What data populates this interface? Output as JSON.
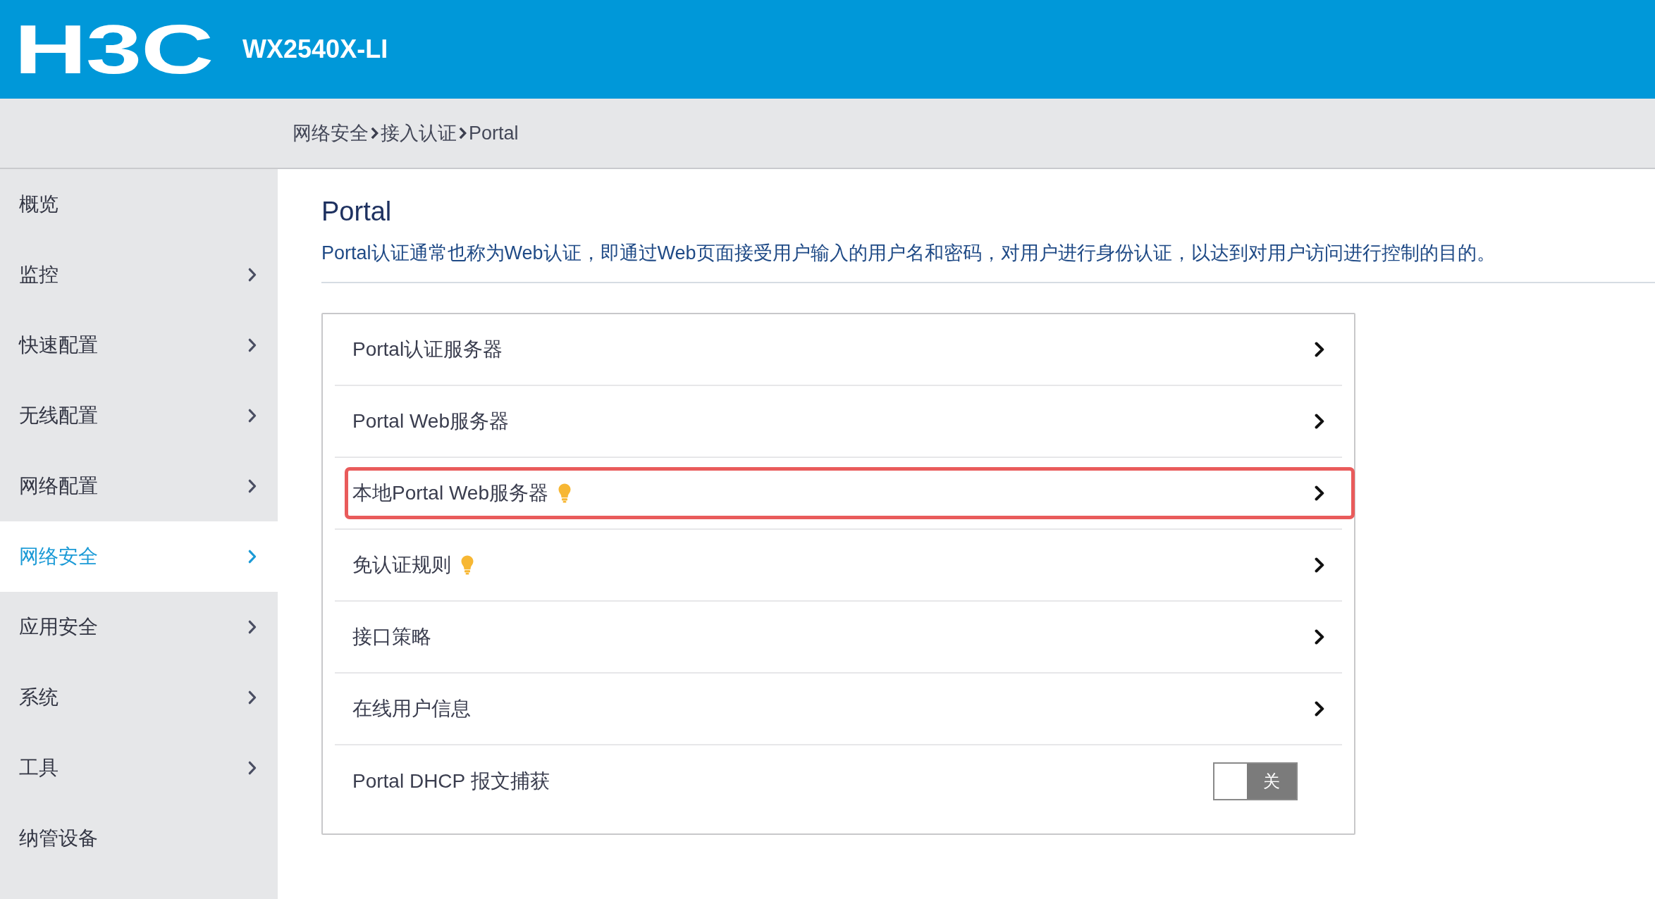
{
  "header": {
    "logo": "H3C",
    "model": "WX2540X-LI"
  },
  "breadcrumb": [
    "网络安全",
    "接入认证",
    "Portal"
  ],
  "sidebar": {
    "items": [
      {
        "label": "概览",
        "has_submenu": false,
        "selected": false
      },
      {
        "label": "监控",
        "has_submenu": true,
        "selected": false
      },
      {
        "label": "快速配置",
        "has_submenu": true,
        "selected": false
      },
      {
        "label": "无线配置",
        "has_submenu": true,
        "selected": false
      },
      {
        "label": "网络配置",
        "has_submenu": true,
        "selected": false
      },
      {
        "label": "网络安全",
        "has_submenu": true,
        "selected": true
      },
      {
        "label": "应用安全",
        "has_submenu": true,
        "selected": false
      },
      {
        "label": "系统",
        "has_submenu": true,
        "selected": false
      },
      {
        "label": "工具",
        "has_submenu": true,
        "selected": false
      },
      {
        "label": "纳管设备",
        "has_submenu": false,
        "selected": false
      }
    ]
  },
  "page": {
    "title": "Portal",
    "description": "Portal认证通常也称为Web认证，即通过Web页面接受用户输入的用户名和密码，对用户进行身份认证，以达到对用户访问进行控制的目的。"
  },
  "entries": [
    {
      "kind": "link",
      "label": "Portal认证服务器",
      "tip": false,
      "highlighted": false
    },
    {
      "kind": "link",
      "label": "Portal Web服务器",
      "tip": false,
      "highlighted": false
    },
    {
      "kind": "link",
      "label": "本地Portal Web服务器",
      "tip": true,
      "highlighted": true
    },
    {
      "kind": "link",
      "label": "免认证规则",
      "tip": true,
      "highlighted": false
    },
    {
      "kind": "link",
      "label": "接口策略",
      "tip": false,
      "highlighted": false
    },
    {
      "kind": "link",
      "label": "在线用户信息",
      "tip": false,
      "highlighted": false
    },
    {
      "kind": "toggle",
      "label": "Portal DHCP 报文捕获",
      "on": false,
      "state_text": "关"
    }
  ]
}
